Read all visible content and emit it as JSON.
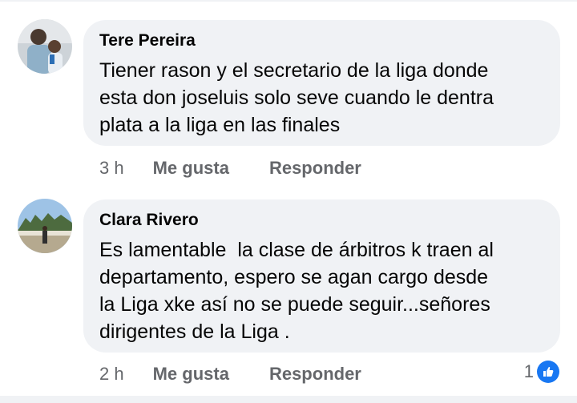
{
  "comments": [
    {
      "author": "Tere Pereira",
      "text": "Tiener rason y el secretario de la liga donde\nesta don joseluis solo seve cuando le dentra\nplata a la liga en las finales",
      "time": "3 h",
      "like_label": "Me gusta",
      "reply_label": "Responder"
    },
    {
      "author": "Clara Rivero",
      "text": "Es lamentable  la clase de árbitros k traen al\ndepartamento, espero se agan cargo desde\nla Liga xke así no se puede seguir...señores\ndirigentes de la Liga .",
      "time": "2 h",
      "like_label": "Me gusta",
      "reply_label": "Responder",
      "reaction_count": "1",
      "reaction_icon": "like-icon"
    }
  ],
  "colors": {
    "accent": "#1877f2",
    "bubble": "#f0f2f5",
    "muted": "#65676b"
  }
}
